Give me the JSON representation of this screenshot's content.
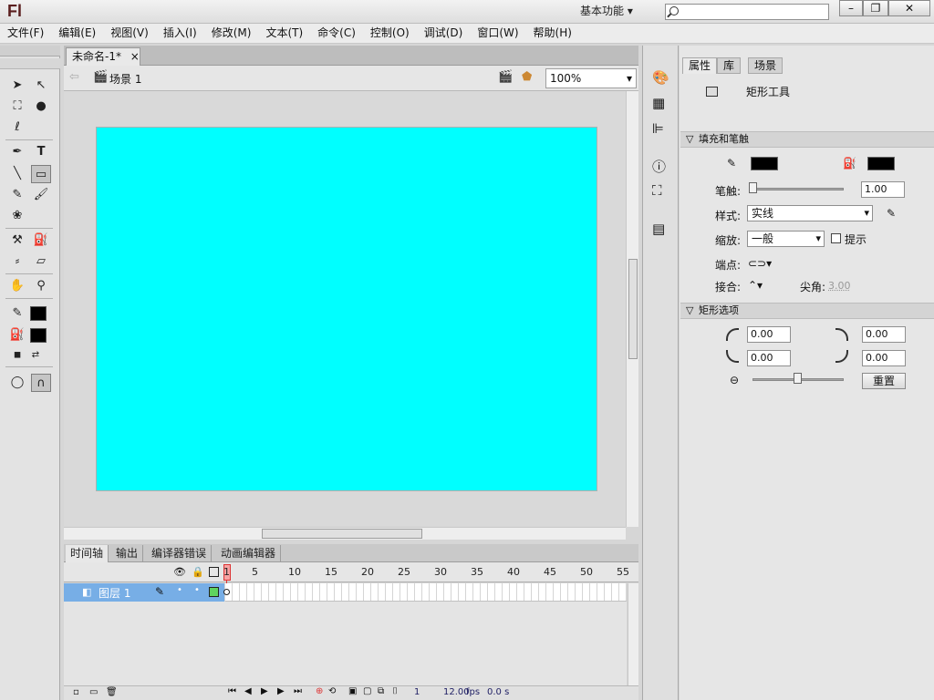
{
  "app": {
    "logo": "Fl",
    "workspace": "基本功能",
    "search_placeholder": ""
  },
  "window_controls": {
    "minimize": "–",
    "maximize": "❐",
    "close": "✕"
  },
  "menu": [
    "文件(F)",
    "编辑(E)",
    "视图(V)",
    "插入(I)",
    "修改(M)",
    "文本(T)",
    "命令(C)",
    "控制(O)",
    "调试(D)",
    "窗口(W)",
    "帮助(H)"
  ],
  "document": {
    "tab": "未命名-1*",
    "tab_close": "×",
    "scene": "场景 1",
    "zoom": "100%",
    "stage_color": "#00ffff"
  },
  "timeline": {
    "tabs": [
      "时间轴",
      "输出",
      "编译器错误",
      "动画编辑器"
    ],
    "ruler": [
      "1",
      "5",
      "10",
      "15",
      "20",
      "25",
      "30",
      "35",
      "40",
      "45",
      "50",
      "55"
    ],
    "layer_name": "图层 1",
    "frame": "1",
    "fps": "12.00",
    "fps_unit": "fps",
    "time": "0.0 s"
  },
  "panel": {
    "tabs": [
      "属性",
      "库",
      "场景"
    ],
    "tool_name": "矩形工具",
    "fill_stroke": {
      "header": "填充和笔触",
      "stroke_color": "#000000",
      "fill_color": "#000000"
    },
    "stroke_label": "笔触:",
    "stroke_value": "1.00",
    "style_label": "样式:",
    "style_value": "实线",
    "scale_label": "缩放:",
    "scale_value": "一般",
    "hint_label": "提示",
    "cap_label": "端点:",
    "join_label": "接合:",
    "miter_label": "尖角:",
    "miter_value": "3.00",
    "rect_options": {
      "header": "矩形选项",
      "tl": "0.00",
      "tr": "0.00",
      "bl": "0.00",
      "br": "0.00",
      "reset": "重置"
    }
  }
}
